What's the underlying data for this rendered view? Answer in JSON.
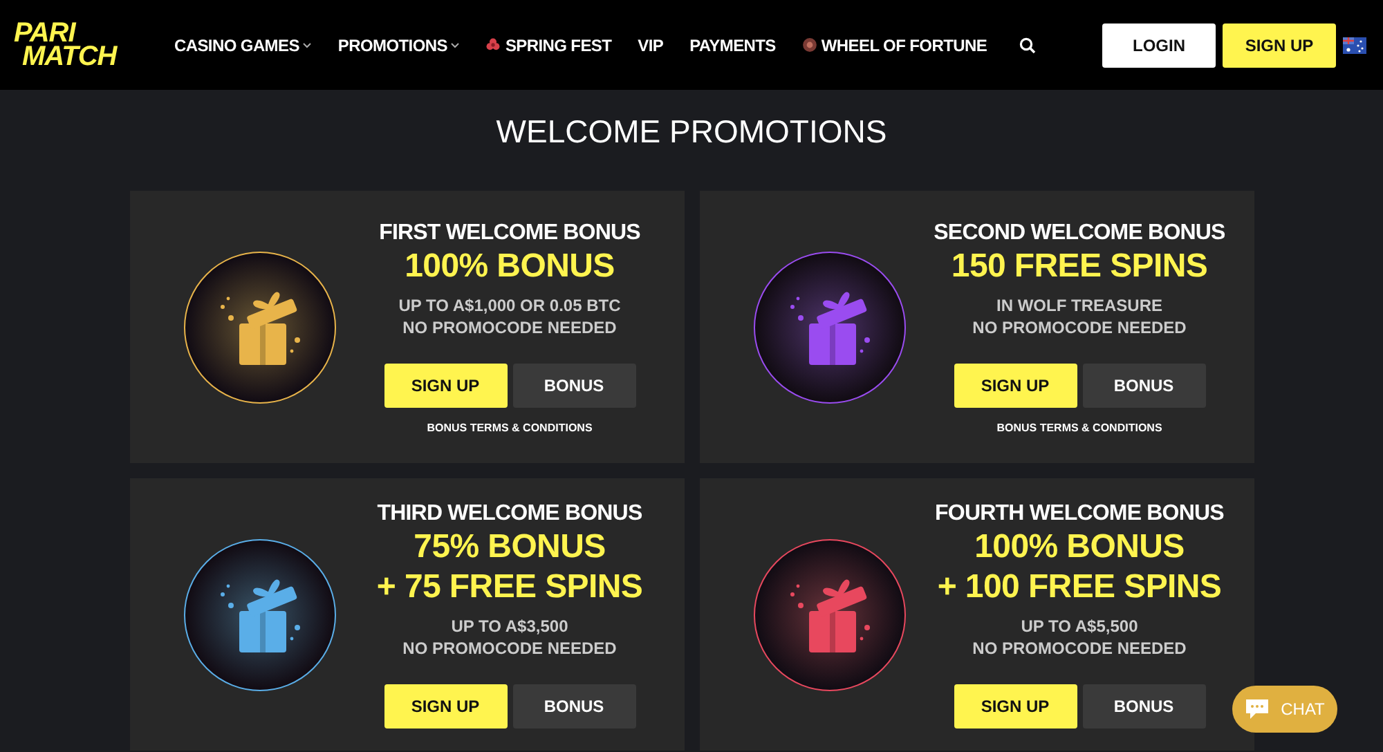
{
  "header": {
    "logo": [
      "PARI",
      "MATCH"
    ],
    "nav": [
      {
        "label": "CASINO GAMES",
        "kind": "dropdown"
      },
      {
        "label": "PROMOTIONS",
        "kind": "dropdown"
      },
      {
        "label": "SPRING FEST",
        "kind": "flower"
      },
      {
        "label": "VIP",
        "kind": "plain"
      },
      {
        "label": "PAYMENTS",
        "kind": "plain"
      },
      {
        "label": "WHEEL OF FORTUNE",
        "kind": "wheel"
      }
    ],
    "login": "LOGIN",
    "signup": "SIGN UP"
  },
  "title": "WELCOME PROMOTIONS",
  "cards": [
    {
      "title": "FIRST WELCOME BONUS",
      "offer": [
        "100% BONUS"
      ],
      "details": [
        "UP TO A$1,000 OR 0.05 BTC",
        "NO PROMOCODE NEEDED"
      ],
      "color": "#e8b44a",
      "signup": "SIGN UP",
      "bonus": "BONUS",
      "terms": "BONUS TERMS & CONDITIONS"
    },
    {
      "title": "SECOND WELCOME BONUS",
      "offer": [
        "150 FREE SPINS"
      ],
      "details": [
        "IN WOLF TREASURE",
        "NO PROMOCODE NEEDED"
      ],
      "color": "#9a4cf0",
      "signup": "SIGN UP",
      "bonus": "BONUS",
      "terms": "BONUS TERMS & CONDITIONS"
    },
    {
      "title": "THIRD WELCOME BONUS",
      "offer": [
        "75% BONUS",
        "+ 75 FREE SPINS"
      ],
      "details": [
        "UP TO A$3,500",
        "NO PROMOCODE NEEDED"
      ],
      "color": "#5aaee8",
      "signup": "SIGN UP",
      "bonus": "BONUS"
    },
    {
      "title": "FOURTH WELCOME BONUS",
      "offer": [
        "100% BONUS",
        "+ 100 FREE SPINS"
      ],
      "details": [
        "UP TO A$5,500",
        "NO PROMOCODE NEEDED"
      ],
      "color": "#e8485e",
      "signup": "SIGN UP",
      "bonus": "BONUS"
    }
  ],
  "chat": "CHAT"
}
